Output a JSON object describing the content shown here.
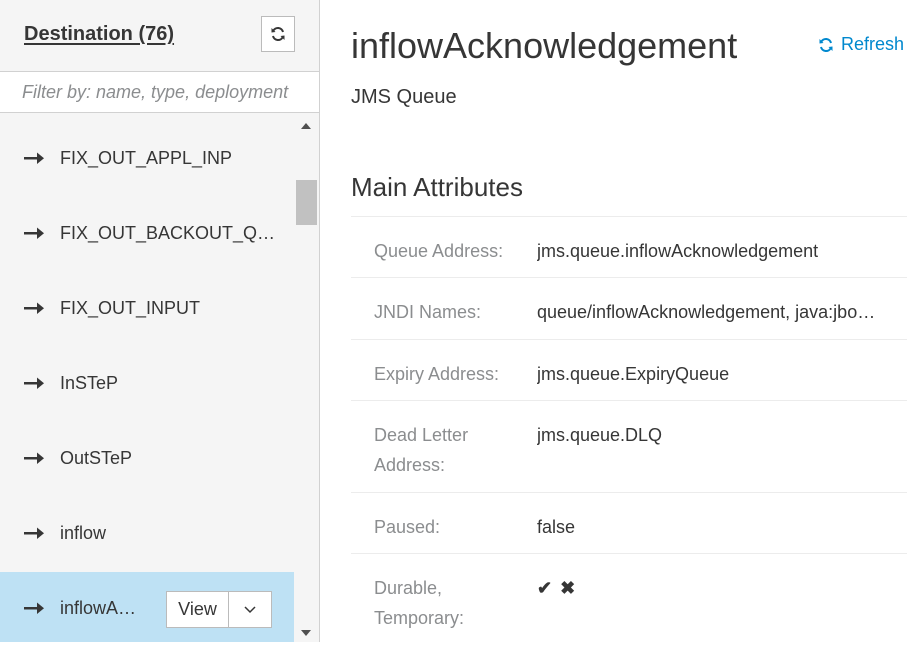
{
  "sidebar": {
    "title": "Destination (76)",
    "filter_placeholder": "Filter by: name, type, deployment",
    "refresh_icon": "refresh-icon",
    "items": [
      {
        "label": "FIX_OUT_APPL_INP"
      },
      {
        "label": "FIX_OUT_BACKOUT_QUEUE"
      },
      {
        "label": "FIX_OUT_INPUT"
      },
      {
        "label": "InSTeP"
      },
      {
        "label": "OutSTeP"
      },
      {
        "label": "inflow"
      },
      {
        "label": "inflowAcknowledgement",
        "selected": true
      }
    ],
    "view_label": "View"
  },
  "main": {
    "title": "inflowAcknowledgement",
    "refresh_label": "Refresh",
    "subtitle": "JMS Queue",
    "section_title": "Main Attributes",
    "attributes": [
      {
        "key": "Queue Address:",
        "value": "jms.queue.inflowAcknowledgement"
      },
      {
        "key": "JNDI Names:",
        "value": "queue/inflowAcknowledgement, java:jboss/exported/jms/queue/inflowAcknowledgement"
      },
      {
        "key": "Expiry Address:",
        "value": "jms.queue.ExpiryQueue"
      },
      {
        "key": "Dead Letter Address:",
        "value": "jms.queue.DLQ"
      },
      {
        "key": "Paused:",
        "value": "false"
      },
      {
        "key": "Durable, Temporary:",
        "durable": "✔",
        "temporary": "✖"
      }
    ]
  },
  "colors": {
    "accent": "#0088ce",
    "selected_bg": "#bee1f4",
    "sidebar_bg": "#f5f5f5"
  }
}
